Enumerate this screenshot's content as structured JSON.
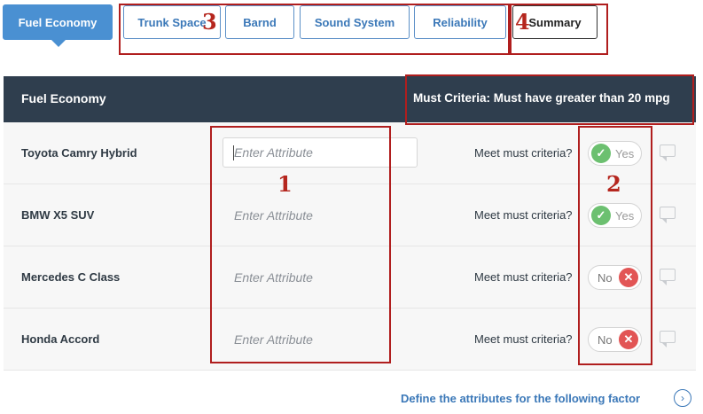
{
  "tabs": [
    {
      "label": "Fuel Economy"
    },
    {
      "label": "Trunk Space"
    },
    {
      "label": "Barnd"
    },
    {
      "label": "Sound System"
    },
    {
      "label": "Reliability"
    },
    {
      "label": "Summary"
    }
  ],
  "header": {
    "title": "Fuel Economy",
    "criteria": "Must Criteria: Must have greater than 20 mpg"
  },
  "rows": [
    {
      "name": "Toyota Camry Hybrid",
      "attribute_placeholder": "Enter Attribute",
      "meet_label": "Meet must criteria?",
      "toggle": "Yes"
    },
    {
      "name": "BMW X5 SUV",
      "attribute_placeholder": "Enter Attribute",
      "meet_label": "Meet must criteria?",
      "toggle": "Yes"
    },
    {
      "name": "Mercedes C Class",
      "attribute_placeholder": "Enter Attribute",
      "meet_label": "Meet must criteria?",
      "toggle": "No"
    },
    {
      "name": "Honda Accord",
      "attribute_placeholder": "Enter Attribute",
      "meet_label": "Meet must criteria?",
      "toggle": "No"
    }
  ],
  "annotations": [
    "1",
    "2",
    "3",
    "4"
  ],
  "footer": {
    "link": "Define the attributes for the following factor",
    "icon": "chevron-right-circle-icon"
  },
  "colors": {
    "accent": "#4a90d2",
    "header": "#2f3e4e",
    "yes": "#6cc070",
    "no": "#e25555",
    "annotation": "#b01e1e"
  }
}
